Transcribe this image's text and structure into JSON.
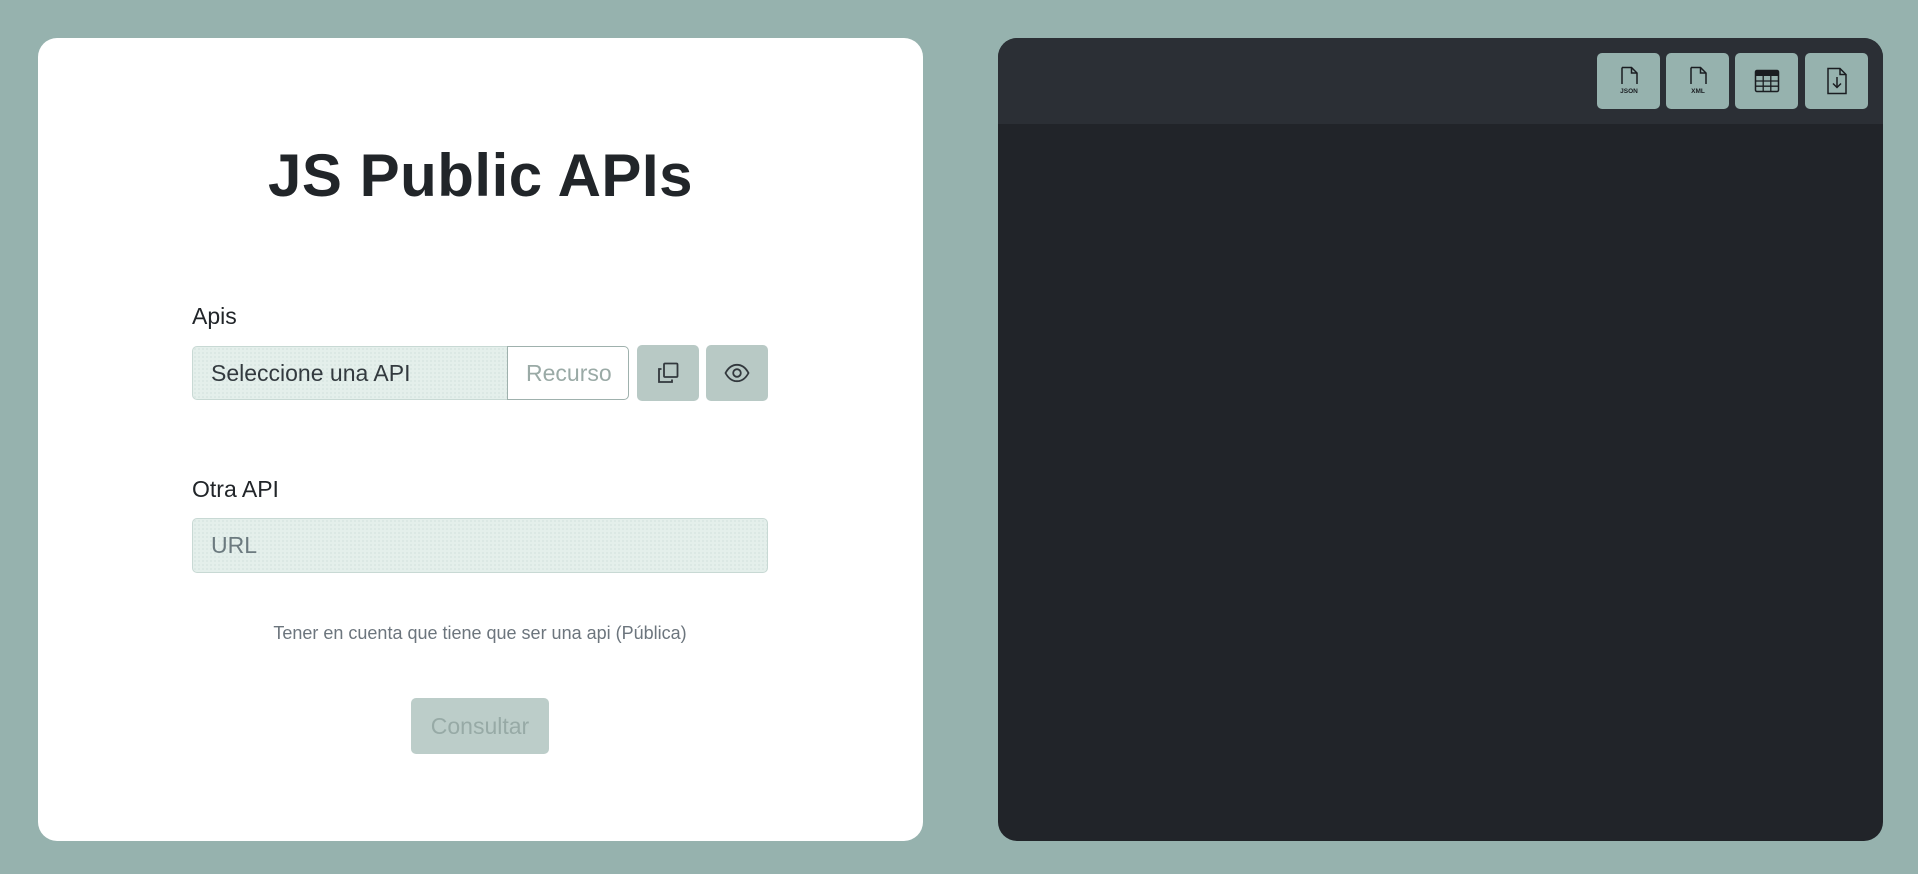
{
  "app": {
    "title": "JS Public APIs"
  },
  "form": {
    "apis_label": "Apis",
    "api_select_value": "Seleccione una API",
    "resource_placeholder": "Recurso",
    "other_api_label": "Otra API",
    "url_placeholder": "URL",
    "hint": "Tener en cuenta que tiene que ser una api (Pública)",
    "submit_label": "Consultar"
  },
  "toolbar": {
    "json_label": "JSON",
    "xml_label": "XML"
  },
  "icons": {
    "copy": "copy-icon",
    "eye": "eye-icon",
    "json_file": "json-file-icon",
    "xml_file": "xml-file-icon",
    "table": "table-icon",
    "download": "file-download-icon"
  },
  "colors": {
    "background": "#96b2ae",
    "card": "#ffffff",
    "output_panel": "#212429",
    "toolbar": "#2b2f35",
    "button_accent": "#b8c9c5",
    "text": "#212529"
  }
}
